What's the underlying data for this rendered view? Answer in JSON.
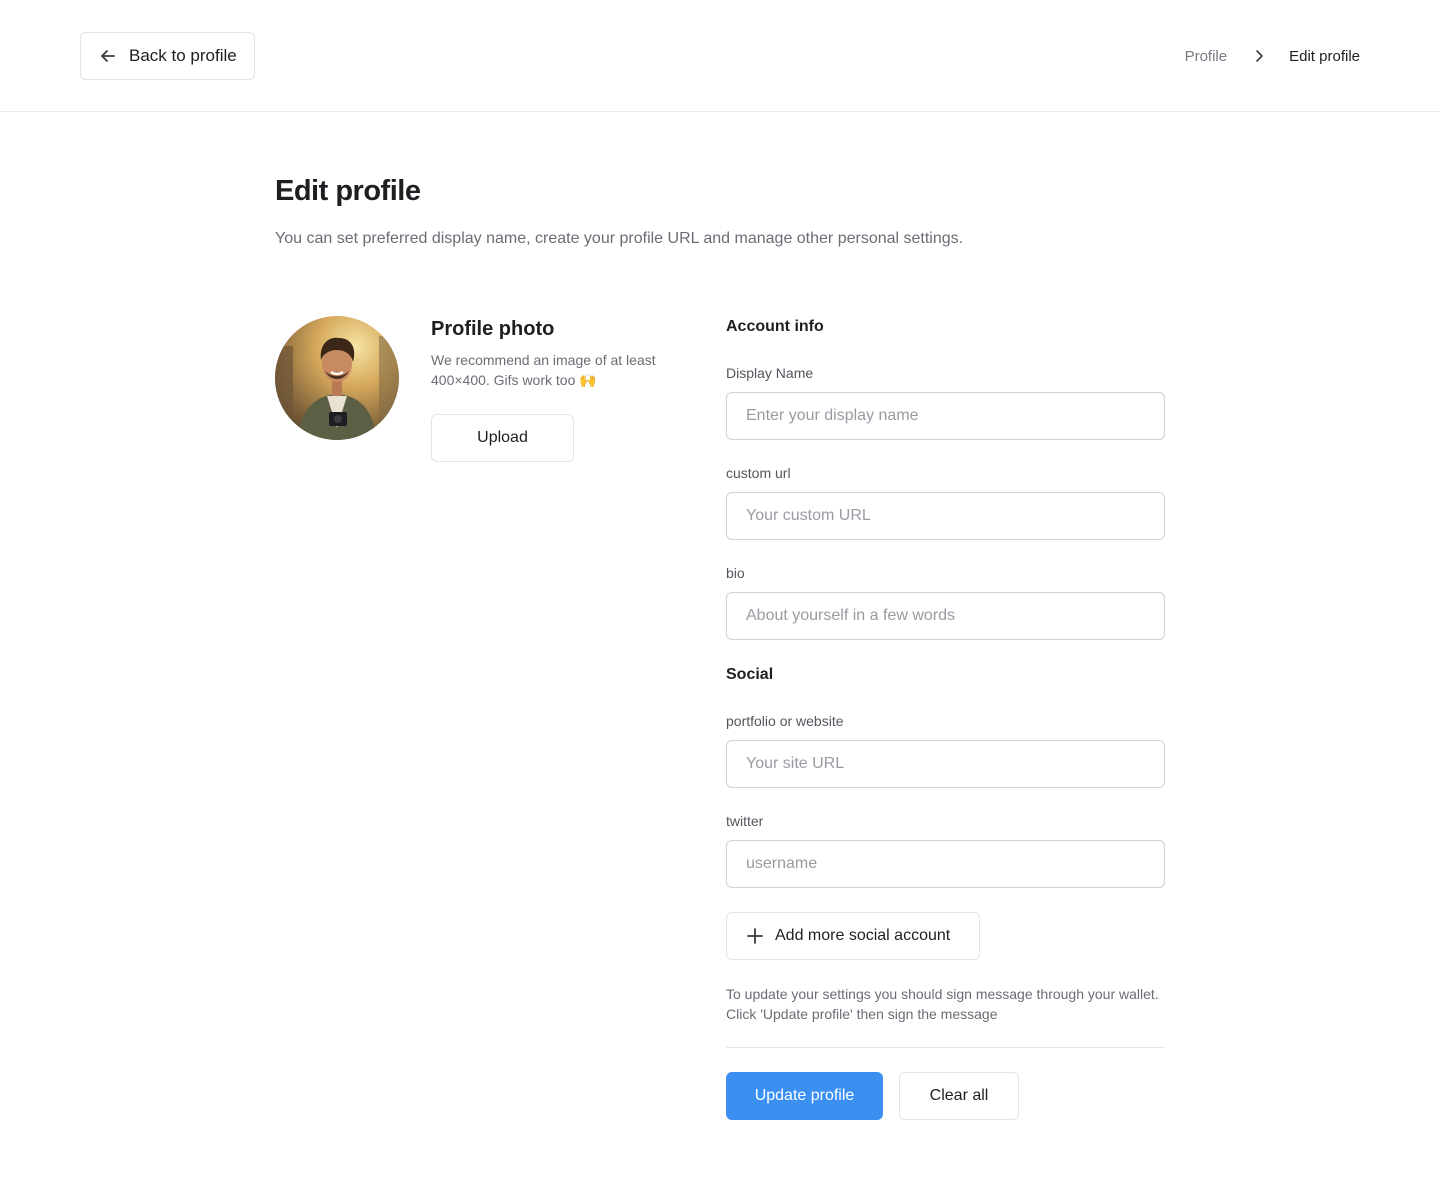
{
  "header": {
    "back_label": "Back to profile",
    "back_icon": "arrow-left-icon",
    "breadcrumb": {
      "parent": "Profile",
      "separator_icon": "chevron-right-icon",
      "current": "Edit profile"
    }
  },
  "page": {
    "title": "Edit profile",
    "subtitle": "You can set preferred display name, create your profile URL and manage other personal settings."
  },
  "photo": {
    "title": "Profile photo",
    "hint": "We recommend an image of at least 400×400. Gifs work too 🙌",
    "upload_label": "Upload"
  },
  "account": {
    "title": "Account info",
    "display_name": {
      "label": "Display Name",
      "placeholder": "Enter your display name",
      "value": ""
    },
    "custom_url": {
      "label": "custom url",
      "placeholder": "Your custom URL",
      "value": ""
    },
    "bio": {
      "label": "bio",
      "placeholder": "About yourself in a few words",
      "value": ""
    }
  },
  "social": {
    "title": "Social",
    "website": {
      "label": "portfolio or website",
      "placeholder": "Your site URL",
      "value": ""
    },
    "twitter": {
      "label": "twitter",
      "placeholder": "username",
      "value": ""
    },
    "add_label": "Add more social account",
    "add_icon": "plus-icon"
  },
  "footer": {
    "note": "To update your settings you should sign message through your wallet. Click 'Update profile' then sign the message",
    "update_label": "Update profile",
    "clear_label": "Clear all"
  },
  "colors": {
    "primary": "#3a8ff0",
    "border": "#cfcfd6",
    "muted_text": "#6c6c76"
  }
}
